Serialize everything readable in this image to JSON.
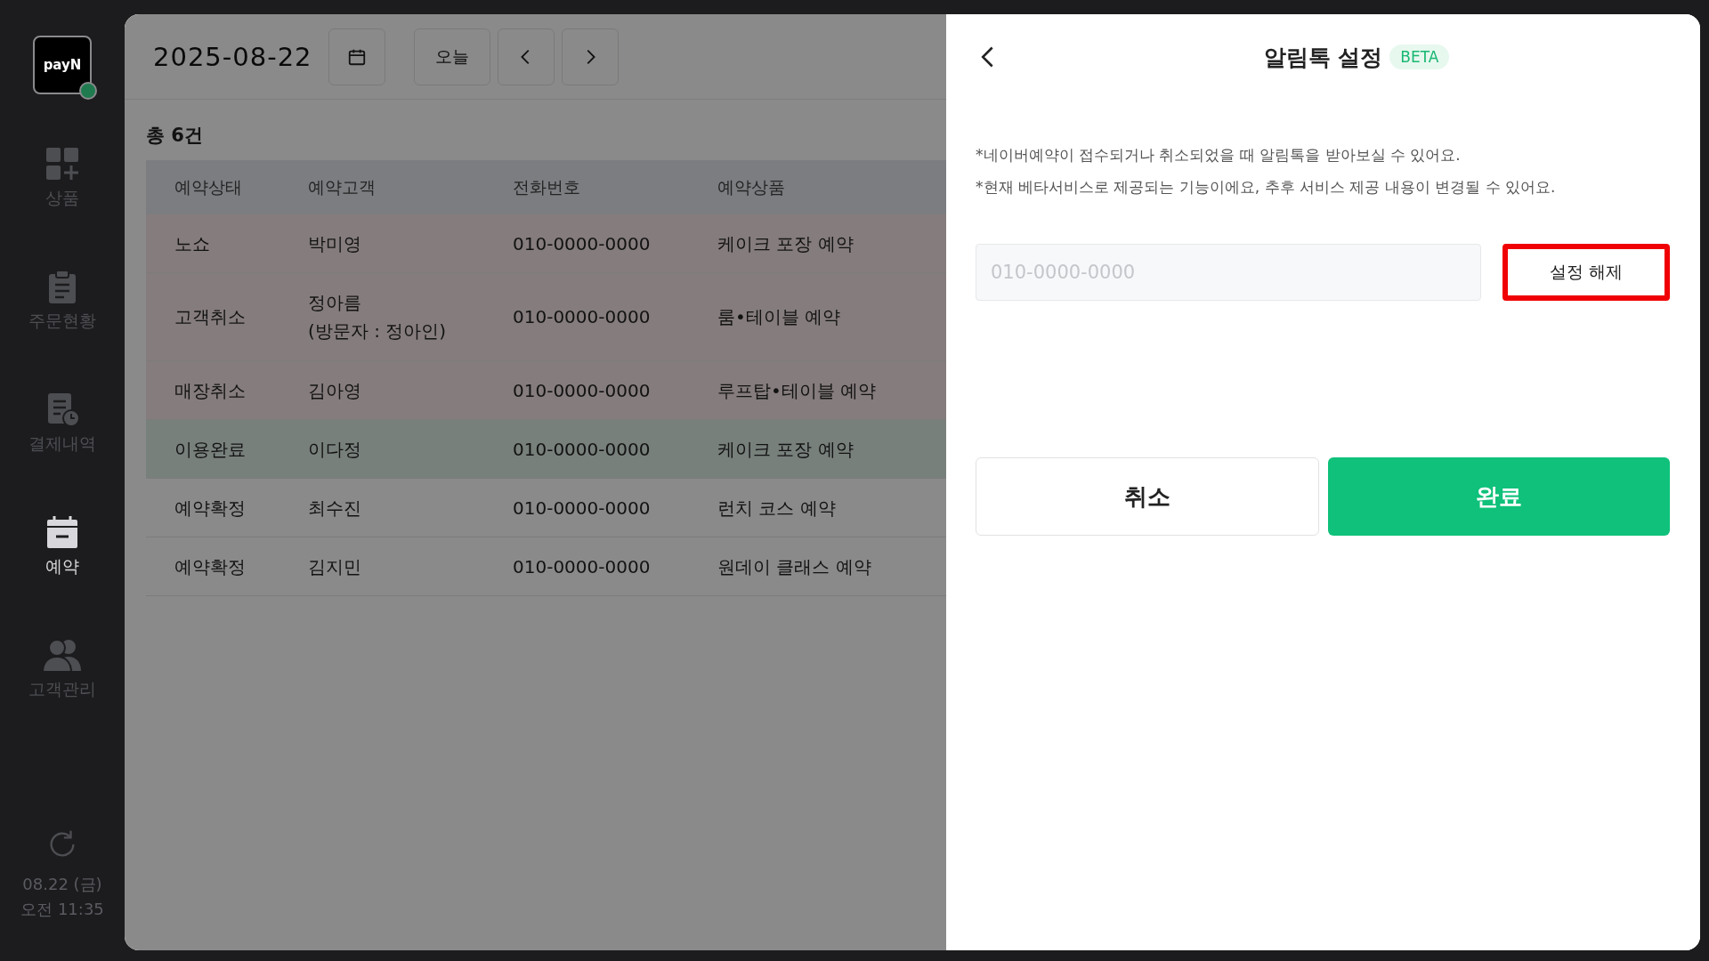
{
  "sidebar": {
    "logo": "pay**N**",
    "online": true,
    "items": [
      {
        "label": "상품",
        "selected": false
      },
      {
        "label": "주문현황",
        "selected": false
      },
      {
        "label": "결제내역",
        "selected": false
      },
      {
        "label": "예약",
        "selected": true
      },
      {
        "label": "고객관리",
        "selected": false
      }
    ],
    "clock": {
      "date": "08.22 (금)",
      "time": "오전 11:35"
    }
  },
  "toolbar": {
    "date": "2025-08-22",
    "today": "오늘"
  },
  "count": "총 6건",
  "table": {
    "columns": [
      "예약상태",
      "예약고객",
      "전화번호",
      "예약상품"
    ],
    "rows": [
      {
        "color": "#857c7d",
        "cells": [
          "노쇼",
          "박미영",
          "010-0000-0000",
          "케이크 포장 예약"
        ]
      },
      {
        "color": "#857c7d",
        "cells": [
          "고객취소",
          "정아름\n(방문자 : 정아인)",
          "010-0000-0000",
          "룸•테이블 예약"
        ]
      },
      {
        "color": "#857c7d",
        "cells": [
          "매장취소",
          "김아영",
          "010-0000-0000",
          "루프탑•테이블 예약"
        ]
      },
      {
        "color": "#78807c",
        "cells": [
          "이용완료",
          "이다정",
          "010-0000-0000",
          "케이크 포장 예약"
        ]
      },
      {
        "color": "#8a8a8a",
        "cells": [
          "예약확정",
          "최수진",
          "010-0000-0000",
          "런치 코스 예약"
        ]
      },
      {
        "color": "#8a8a8a",
        "cells": [
          "예약확정",
          "김지민",
          "010-0000-0000",
          "원데이 클래스 예약"
        ]
      }
    ]
  },
  "panel": {
    "title": "알림톡 설정",
    "badge": "BETA",
    "notes": [
      "*네이버예약이 접수되거나 취소되었을 때 알림톡을 받아보실 수 있어요.",
      "*현재 베타서비스로 제공되는 기능이에요, 추후 서비스 제공 내용이 변경될 수 있어요."
    ],
    "phone_field": {
      "placeholder": "010-0000-0000"
    },
    "unset_button": {
      "label": "설정 해제",
      "highlighted": true
    },
    "cancel_button": "취소",
    "confirm_button": "완료"
  }
}
